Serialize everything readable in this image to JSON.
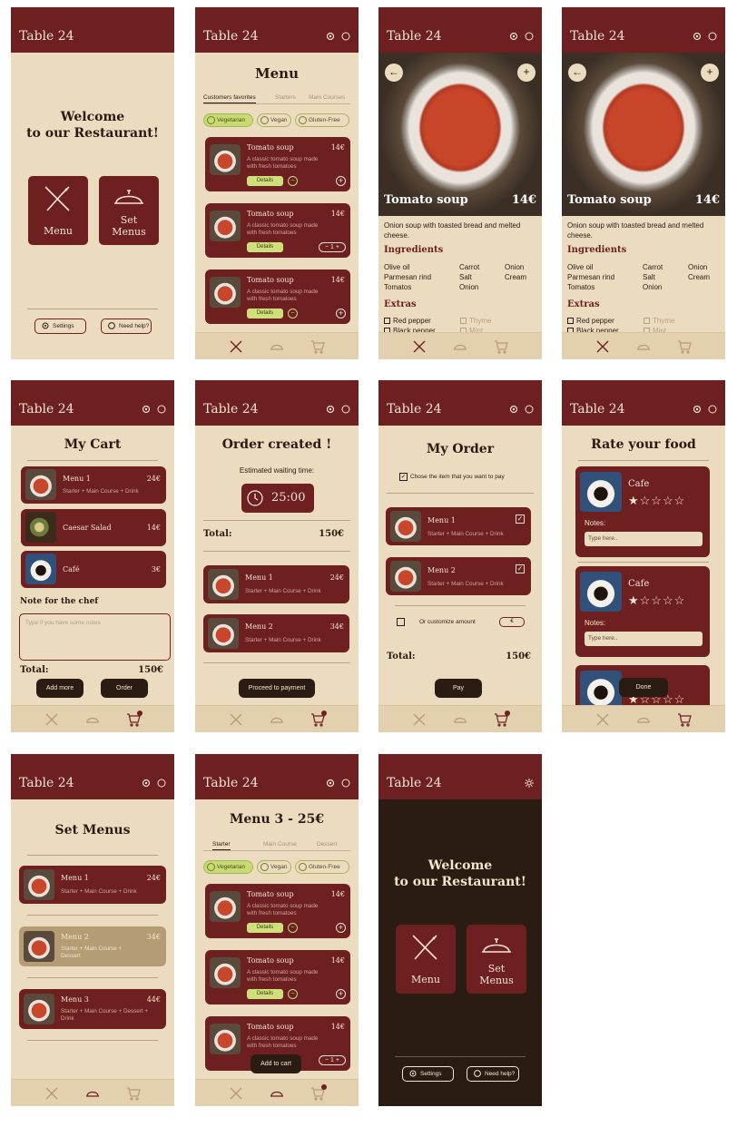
{
  "app": {
    "table": "Table 24"
  },
  "welcome": {
    "line1": "Welcome",
    "line2": "to our Restaurant!",
    "menu": "Menu",
    "set1": "Set",
    "set2": "Menus",
    "settings": "Settings",
    "help": "Need help?"
  },
  "menu": {
    "title": "Menu",
    "tabs": [
      "Customers favorites",
      "Starters",
      "Main Courses"
    ],
    "chips": [
      "Vegetarian",
      "Vegan",
      "Gluten-Free"
    ],
    "item": {
      "name": "Tomato soup",
      "price": "14€",
      "desc": "A classic tomato soup made with fresh tomatoes",
      "details": "Details"
    },
    "stepper": "1"
  },
  "detail": {
    "name": "Tomato soup",
    "price": "14€",
    "desc": "Onion soup with toasted bread and melted cheese.",
    "ingredients_title": "Ingredients",
    "ingredients": [
      "Olive oil",
      "Carrot",
      "Onion",
      "Parmesan rind",
      "Salt",
      "Cream",
      "Tomatos",
      "Onion"
    ],
    "extras_title": "Extras",
    "extras": [
      {
        "label": "Red pepper",
        "checked": true
      },
      {
        "label": "Thyme",
        "checked": false
      },
      {
        "label": "Black pepper",
        "checked": true
      },
      {
        "label": "Mint",
        "checked": false
      }
    ]
  },
  "cart": {
    "title": "My Cart",
    "items": [
      {
        "name": "Menu 1",
        "price": "24€",
        "sub": "Starter + Main Course + Drink"
      },
      {
        "name": "Caesar Salad",
        "price": "14€",
        "sub": ""
      },
      {
        "name": "Café",
        "price": "3€",
        "sub": ""
      }
    ],
    "note_label": "Note for the chef",
    "note_placeholder": "Type if you have some notes",
    "total_label": "Total:",
    "total": "150€",
    "add_more": "Add more",
    "order": "Order"
  },
  "created": {
    "title": "Order created !",
    "waiting": "Estimated waiting time:",
    "time": "25:00",
    "total_label": "Total:",
    "total": "150€",
    "items": [
      {
        "name": "Menu 1",
        "price": "24€",
        "sub": "Starter + Main Course + Drink"
      },
      {
        "name": "Menu 2",
        "price": "34€",
        "sub": "Starter + Main Course + Drink"
      }
    ],
    "proceed": "Proceed to payment"
  },
  "myorder": {
    "title": "My Order",
    "choose": "Chose the item that you want to pay",
    "items": [
      {
        "name": "Menu 1",
        "sub": "Starter + Main Course + Drink"
      },
      {
        "name": "Menu 2",
        "sub": "Starter + Main Course + Drink"
      }
    ],
    "custom": "Or customize amount",
    "currency": "€",
    "total_label": "Total:",
    "total": "150€",
    "pay": "Pay"
  },
  "rate": {
    "title": "Rate your food",
    "items": [
      {
        "name": "Cafe",
        "rating": 1
      },
      {
        "name": "Cafe",
        "rating": 1
      }
    ],
    "stars": "★☆☆☆☆",
    "notes_label": "Notes:",
    "notes_placeholder": "Type here..",
    "done": "Done"
  },
  "setmenus": {
    "title": "Set Menus",
    "items": [
      {
        "name": "Menu 1",
        "price": "24€",
        "sub": "Starter + Main Course + Drink"
      },
      {
        "name": "Menu 2",
        "price": "34€",
        "sub": "Starter + Main Course + Dessert"
      },
      {
        "name": "Menu 3",
        "price": "44€",
        "sub": "Starter + Main Course + Dessert + Drink"
      }
    ]
  },
  "menu3": {
    "title": "Menu 3 - 25€",
    "tabs": [
      "Starter",
      "Main Course",
      "Dessert"
    ],
    "add_to_cart": "Add to cart"
  },
  "colors": {
    "header": "#6e1f1f",
    "background": "#ecdcbf",
    "dark": "#2a1c13",
    "chip": "#c8db72"
  }
}
